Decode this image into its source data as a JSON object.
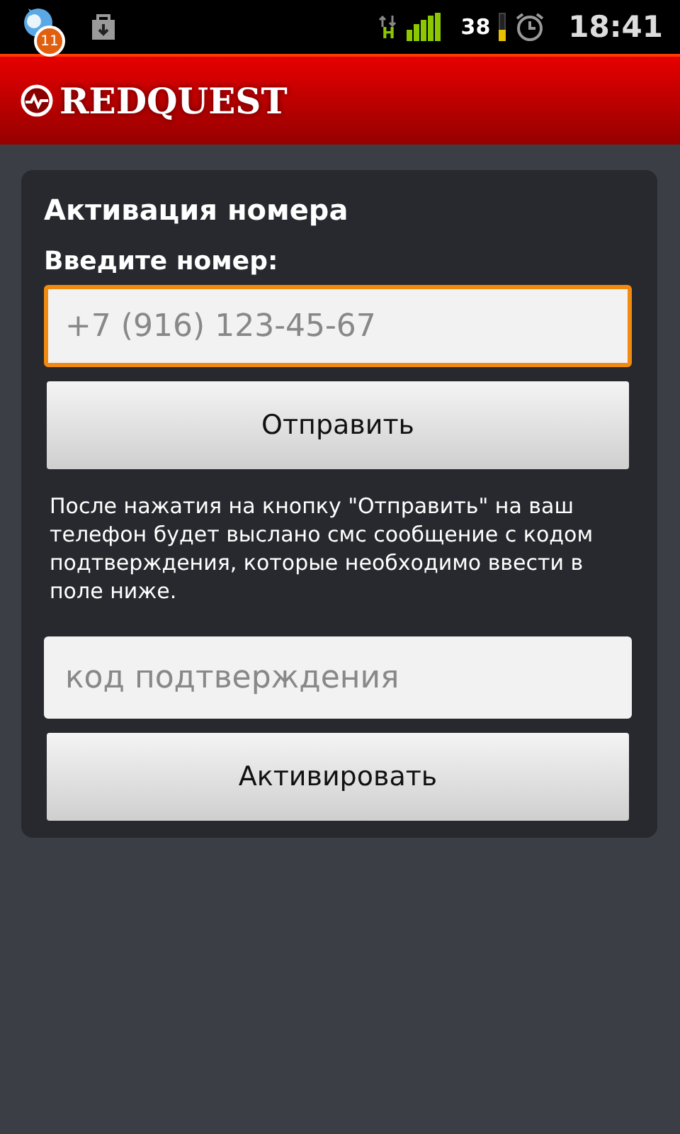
{
  "status_bar": {
    "notification_count": "11",
    "network_type": "H",
    "battery": "38",
    "time": "18:41"
  },
  "header": {
    "logo": "REDQUEST"
  },
  "form": {
    "title": "Активация номера",
    "phone_label": "Введите номер:",
    "phone_field": {
      "placeholder": "+7 (916) 123-45-67",
      "focused": true
    },
    "send_button": "Отправить",
    "info": "После нажатия на кнопку \"Отправить\" на ваш телефон будет выслано смс сообщение с кодом подтверждения, которые необходимо ввести в поле ниже.",
    "code_field": {
      "placeholder": "код подтверждения",
      "focused": false
    },
    "activate_button": "Активировать"
  }
}
